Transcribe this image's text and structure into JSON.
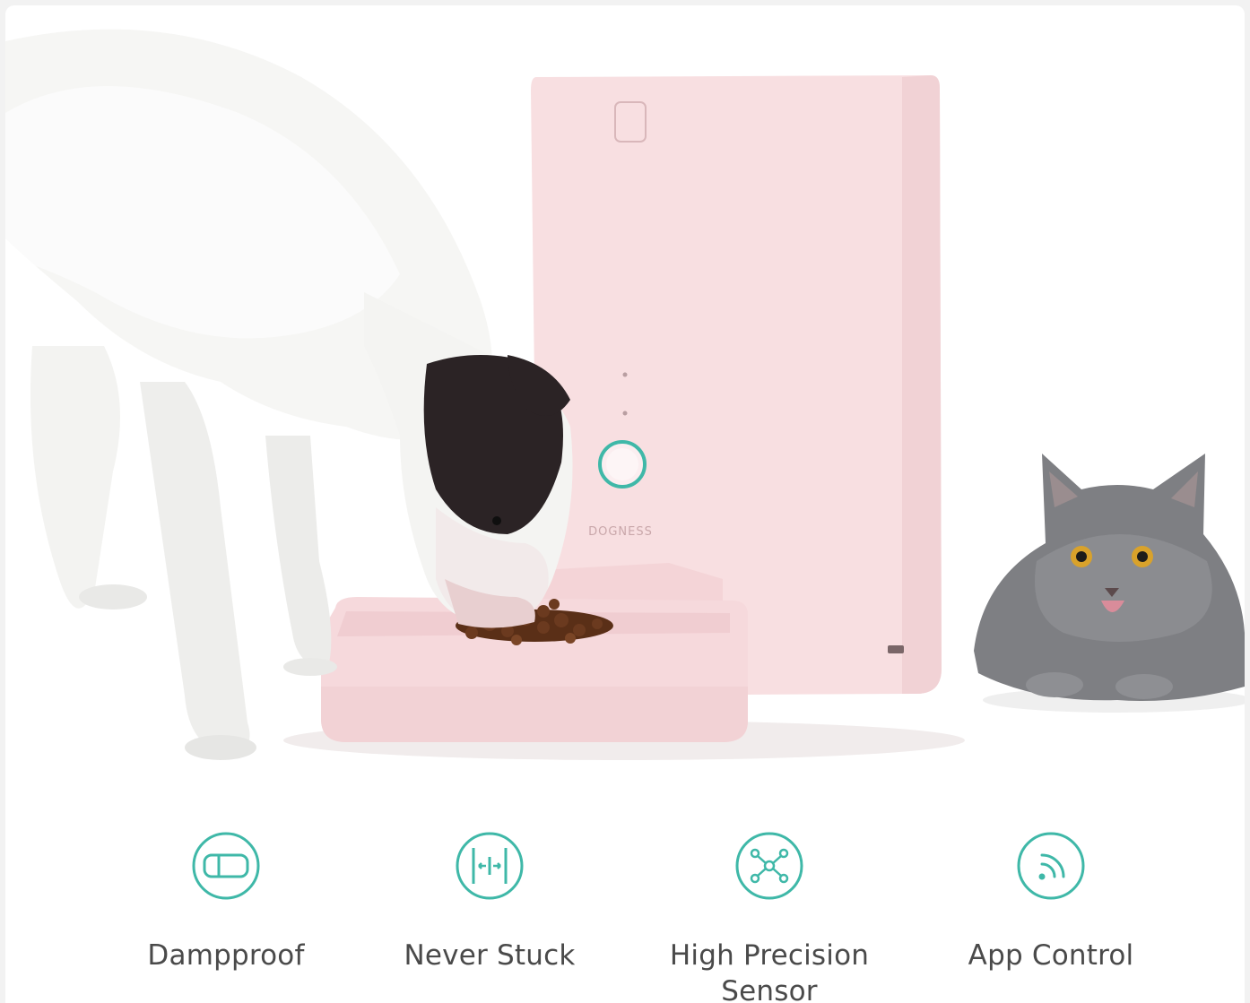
{
  "product": {
    "brand": "DOGNESS",
    "body_color": "#f8dfe1",
    "accent_color": "#3fb8a8"
  },
  "features": [
    {
      "label": "Dampproof",
      "icon": "dampproof-icon"
    },
    {
      "label": "Never Stuck",
      "icon": "never-stuck-icon"
    },
    {
      "label": "High Precision Sensor",
      "icon": "precision-sensor-icon"
    },
    {
      "label": "App Control",
      "icon": "app-control-icon"
    }
  ]
}
